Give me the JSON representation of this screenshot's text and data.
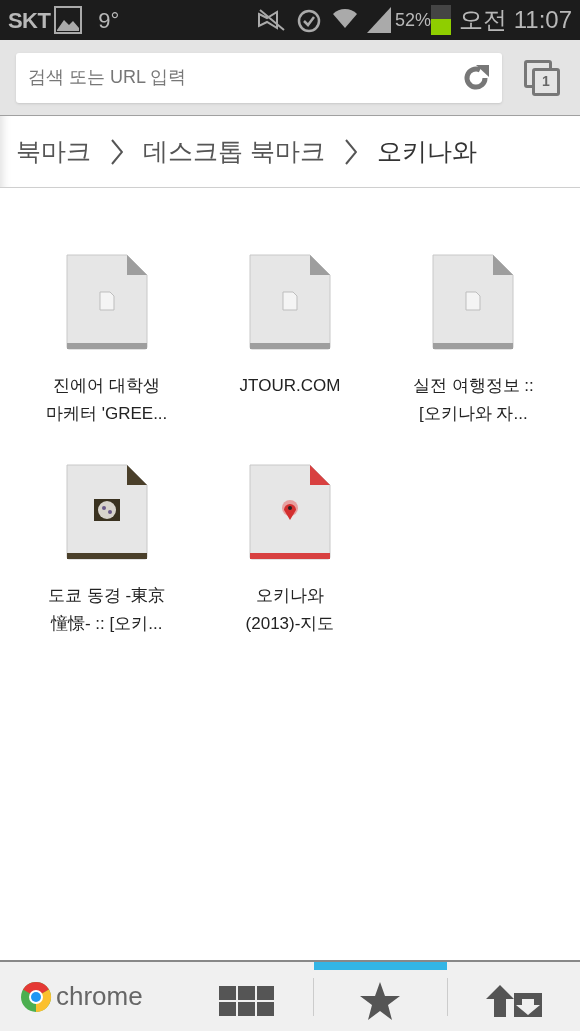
{
  "status_bar": {
    "carrier": "SKT",
    "temperature": "9°",
    "battery": {
      "percent": "52%",
      "level": 0.52
    },
    "time": "오전 11:07"
  },
  "toolbar": {
    "search": {
      "placeholder": "검색 또는 URL 입력"
    },
    "tab_count": "1"
  },
  "breadcrumb": [
    {
      "label": "북마크",
      "selected": false
    },
    {
      "label": "데스크톱 북마크",
      "selected": false
    },
    {
      "label": "오키나와",
      "selected": true
    }
  ],
  "bookmarks": [
    {
      "kind": "generic",
      "color": "#9e9e9e",
      "title_lines": [
        "진에어 대학생",
        "마케터 'GREE..."
      ]
    },
    {
      "kind": "generic",
      "color": "#9e9e9e",
      "title_lines": [
        "JTOUR.COM"
      ]
    },
    {
      "kind": "generic",
      "color": "#9e9e9e",
      "title_lines": [
        "실전 여행정보 ::",
        "[오키나와 자..."
      ]
    },
    {
      "kind": "favicon",
      "color": "#4a3f2a",
      "title_lines": [
        "도쿄 동경 -東京",
        "憧憬- :: [오키..."
      ]
    },
    {
      "kind": "map",
      "color": "#d84040",
      "title_lines": [
        "오키나와",
        "(2013)-지도"
      ]
    }
  ],
  "bottom_bar": {
    "brand": "chrome",
    "tabs": [
      {
        "kind": "grid",
        "selected": false
      },
      {
        "kind": "star",
        "selected": true
      },
      {
        "kind": "sync",
        "selected": false
      }
    ]
  }
}
